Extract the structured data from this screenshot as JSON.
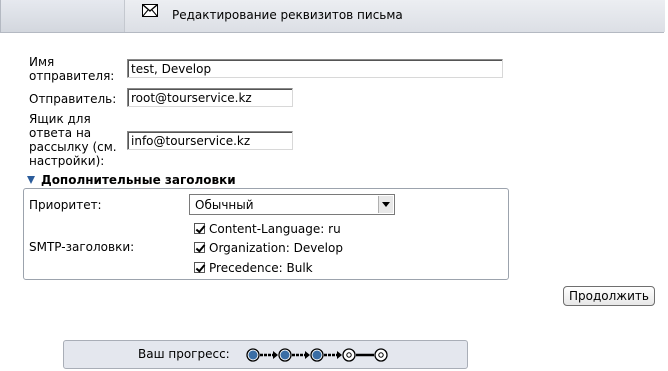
{
  "header": {
    "title": "Редактирование реквизитов письма",
    "icon": "envelope-icon"
  },
  "form": {
    "sender_name": {
      "label_lines": [
        "Имя",
        "отправителя:"
      ],
      "value": "test, Develop"
    },
    "sender": {
      "label": "Отправитель:",
      "value": "root@tourservice.kz"
    },
    "reply_to": {
      "label_lines": [
        "Ящик для",
        "ответа на",
        "рассылку (см.",
        "настройки):"
      ],
      "value": "info@tourservice.kz"
    }
  },
  "additional_headers": {
    "title": "Дополнительные заголовки",
    "priority": {
      "label": "Приоритет:",
      "selected": "Обычный"
    },
    "smtp": {
      "label": "SMTP-заголовки:",
      "items": [
        {
          "label": "Content-Language: ru",
          "checked": true
        },
        {
          "label": "Organization: Develop",
          "checked": true
        },
        {
          "label": "Precedence: Bulk",
          "checked": true
        }
      ]
    }
  },
  "continue_button": "Продолжить",
  "progress": {
    "label": "Ваш прогресс:",
    "completed_steps": 3,
    "total_steps": 5,
    "colors": {
      "done": "#3a6ea5",
      "pending": "#ffffff"
    }
  }
}
